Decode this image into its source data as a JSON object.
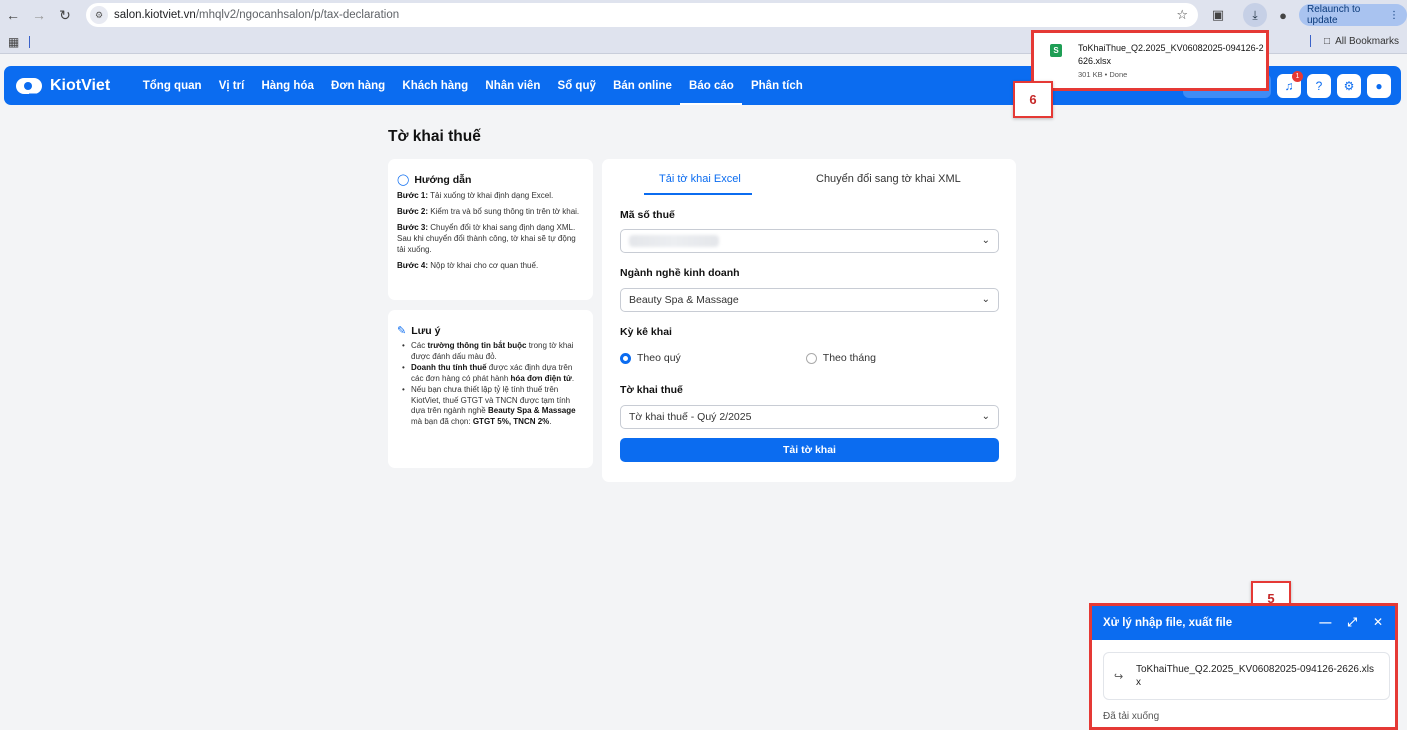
{
  "browser": {
    "url_host": "salon.kiotviet.vn",
    "url_path": "/mhqlv2/ngocanhsalon/p/tax-declaration",
    "relaunch_label": "Relaunch to update",
    "all_bookmarks": "All Bookmarks"
  },
  "app": {
    "logo_text": "KiotViet",
    "menu": [
      "Tổng quan",
      "Vị trí",
      "Hàng hóa",
      "Đơn hàng",
      "Khách hàng",
      "Nhân viên",
      "Sổ quỹ",
      "Bán online",
      "Báo cáo",
      "Phân tích"
    ],
    "active_menu": "Báo cáo",
    "notification_count": "1"
  },
  "page": {
    "title": "Tờ khai thuế"
  },
  "guide": {
    "title": "Hướng dẫn",
    "steps": [
      {
        "label": "Bước 1:",
        "text": " Tải xuống tờ khai định dạng Excel."
      },
      {
        "label": "Bước 2:",
        "text": " Kiểm tra và bổ sung thông tin trên tờ khai."
      },
      {
        "label": "Bước 3:",
        "text": " Chuyển đổi tờ khai sang định dạng XML. Sau khi chuyển đổi thành công, tờ khai sẽ tự động tải xuống."
      },
      {
        "label": "Bước 4:",
        "text": " Nộp tờ khai cho cơ quan thuế."
      }
    ]
  },
  "note": {
    "title": "Lưu ý",
    "items": [
      [
        {
          "t": "Các "
        },
        {
          "b": "trường thông tin bắt buộc"
        },
        {
          "t": " trong tờ khai được đánh dấu màu đỏ."
        }
      ],
      [
        {
          "b": "Doanh thu tính thuế"
        },
        {
          "t": " được xác định dựa trên các đơn hàng có phát hành "
        },
        {
          "b": "hóa đơn điện tử"
        },
        {
          "t": "."
        }
      ],
      [
        {
          "t": "Nếu bạn chưa thiết lập tỷ lệ tính thuế trên KiotViet, thuế GTGT và TNCN được tạm tính dựa trên ngành nghề "
        },
        {
          "b": "Beauty Spa & Massage"
        },
        {
          "t": " mà bạn đã chọn: "
        },
        {
          "b": "GTGT 5%, TNCN 2%"
        },
        {
          "t": "."
        }
      ]
    ]
  },
  "form": {
    "tabs": [
      "Tải tờ khai Excel",
      "Chuyển đổi sang tờ khai XML"
    ],
    "tax_code_label": "Mã số thuế",
    "industry_label": "Ngành nghề kinh doanh",
    "industry_value": "Beauty Spa & Massage",
    "period_label": "Kỳ kê khai",
    "period_options": [
      "Theo quý",
      "Theo tháng"
    ],
    "period_selected": "Theo quý",
    "declaration_label": "Tờ khai thuế",
    "declaration_value": "Tờ khai thuế - Quý 2/2025",
    "submit_label": "Tải tờ khai"
  },
  "download_popup": {
    "file_name": "ToKhaiThue_Q2.2025_KV06082025-094126-2626.xlsx",
    "meta": "301 KB • Done"
  },
  "export_panel": {
    "title": "Xử lý nhập file, xuất file",
    "file_name": "ToKhaiThue_Q2.2025_KV06082025-094126-2626.xlsx",
    "status": "Đã tải xuống"
  },
  "annotations": {
    "tag_download": "6",
    "tag_export": "5"
  },
  "colors": {
    "brand": "#0b6cf0",
    "annotation": "#e53935"
  }
}
